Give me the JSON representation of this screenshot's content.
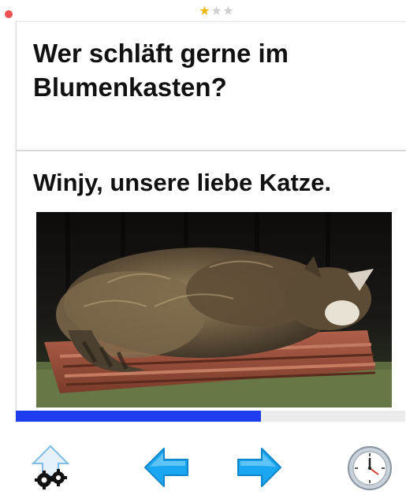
{
  "flashcard": {
    "question": "Wer schläft gerne im Blumenkasten?",
    "answer": "Winjy, unsere liebe Katze.",
    "image_subject": "cat sleeping in a flower box"
  },
  "rating": {
    "value": 1,
    "max": 3
  },
  "progress": {
    "fraction": 0.63
  },
  "toolbar": {
    "settings_icon": "upload-gears-icon",
    "previous_icon": "arrow-left-icon",
    "next_icon": "arrow-right-icon",
    "timer_icon": "clock-icon"
  },
  "colors": {
    "progress": "#1e3cf0",
    "star_filled": "#f2b705",
    "star_empty": "#cfcfcf",
    "arrow": "#1aa7f0",
    "status_dot": "#f0504f"
  }
}
